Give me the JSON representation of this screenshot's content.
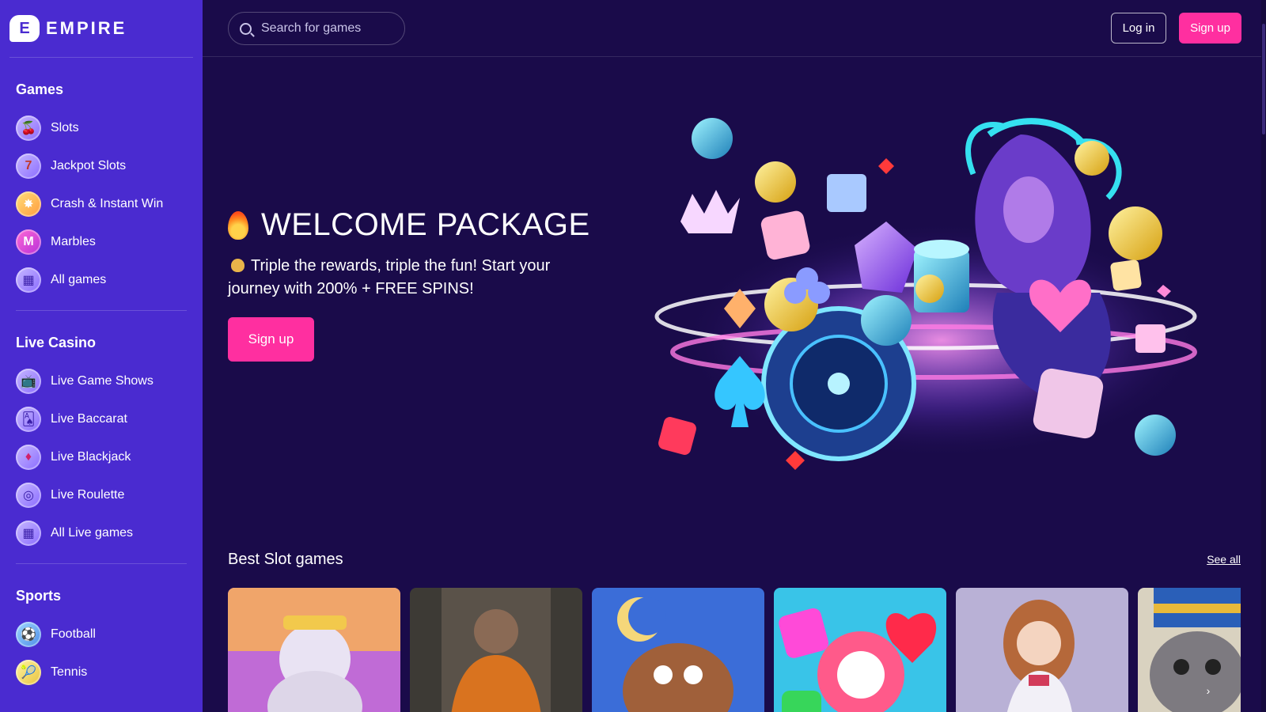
{
  "brand": {
    "name": "EMPIRE",
    "logo_letter": "E"
  },
  "search": {
    "placeholder": "Search for games"
  },
  "header": {
    "login_label": "Log in",
    "signup_label": "Sign up"
  },
  "sidebar": {
    "sections": [
      {
        "title": "Games",
        "items": [
          {
            "label": "Slots",
            "icon": "cherries-icon"
          },
          {
            "label": "Jackpot Slots",
            "icon": "seven-icon"
          },
          {
            "label": "Crash & Instant Win",
            "icon": "explosion-icon"
          },
          {
            "label": "Marbles",
            "icon": "marbles-icon"
          },
          {
            "label": "All games",
            "icon": "grid-icon"
          }
        ]
      },
      {
        "title": "Live Casino",
        "items": [
          {
            "label": "Live Game Shows",
            "icon": "tv-icon"
          },
          {
            "label": "Live Baccarat",
            "icon": "cards-icon"
          },
          {
            "label": "Live Blackjack",
            "icon": "card-icon"
          },
          {
            "label": "Live Roulette",
            "icon": "roulette-icon"
          },
          {
            "label": "All Live games",
            "icon": "grid-icon"
          }
        ]
      },
      {
        "title": "Sports",
        "items": [
          {
            "label": "Football",
            "icon": "football-icon"
          },
          {
            "label": "Tennis",
            "icon": "tennis-icon"
          }
        ]
      }
    ]
  },
  "hero": {
    "title": "WELCOME PACKAGE",
    "text": "Triple the rewards, triple the fun! Start your journey with 200% + FREE SPINS!",
    "cta_label": "Sign up"
  },
  "best_slots": {
    "title": "Best Slot games",
    "see_all_label": "See all"
  },
  "colors": {
    "background": "#1a0b4a",
    "sidebar": "#4a2bd0",
    "accent_pink": "#ff2fa0"
  }
}
